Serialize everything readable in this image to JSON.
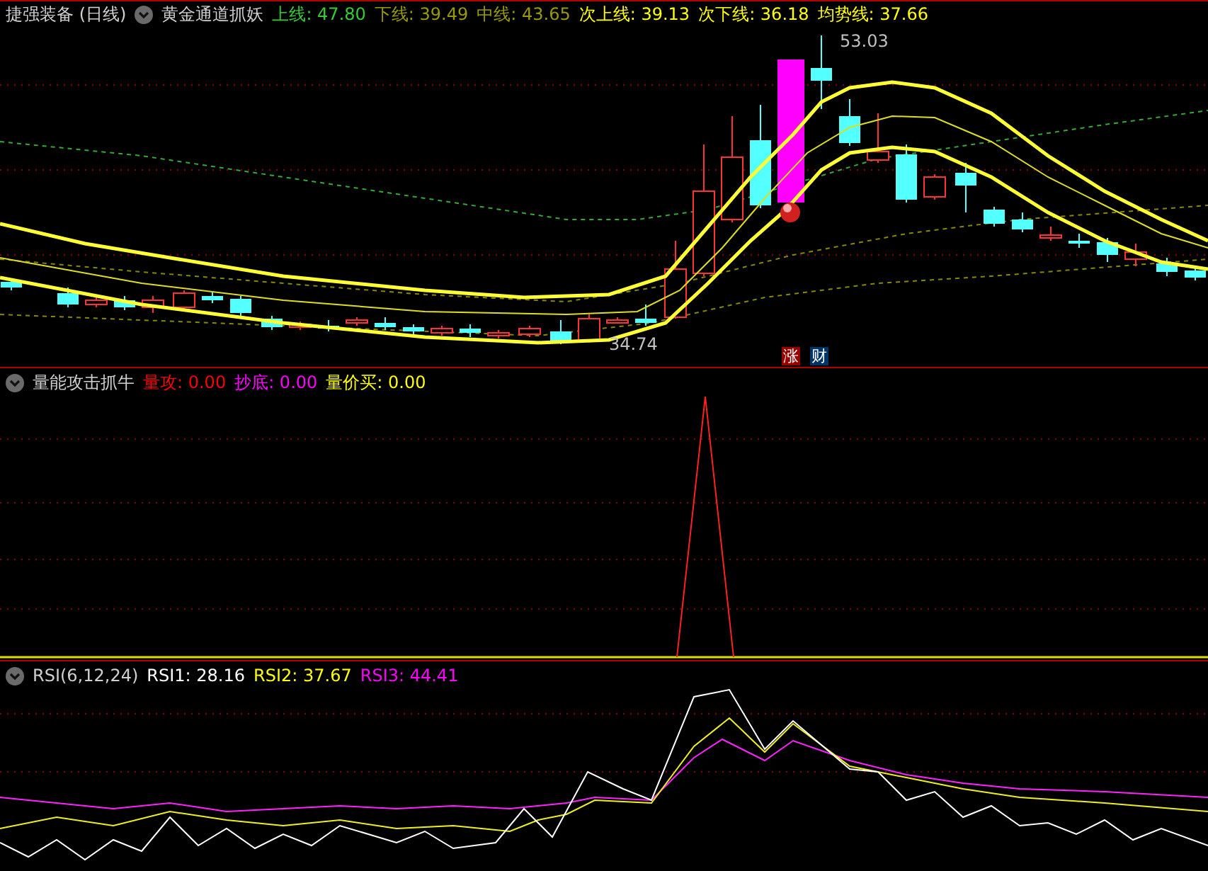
{
  "main_panel": {
    "title": "捷强装备 (日线)",
    "indicator": "黄金通道抓妖",
    "legend": [
      {
        "label": "上线: 47.80",
        "color": "#33cc33"
      },
      {
        "label": "下线: 39.49",
        "color": "#999900"
      },
      {
        "label": "中线: 43.65",
        "color": "#999900"
      },
      {
        "label": "次上线: 39.13",
        "color": "#ffff00"
      },
      {
        "label": "次下线: 36.18",
        "color": "#ffff00"
      },
      {
        "label": "均势线: 37.66",
        "color": "#ffff00"
      }
    ],
    "high_label": "53.03",
    "low_label": "34.74",
    "badges": [
      {
        "text": "涨",
        "color": "#990000"
      },
      {
        "text": "财",
        "color": "#003366"
      }
    ]
  },
  "volume_panel": {
    "indicator": "量能攻击抓牛",
    "legend": [
      {
        "label": "量攻: 0.00",
        "color": "#ff0000"
      },
      {
        "label": "抄底: 0.00",
        "color": "#ff00ff"
      },
      {
        "label": "量价买: 0.00",
        "color": "#ffff00"
      }
    ]
  },
  "rsi_panel": {
    "indicator": "RSI(6,12,24)",
    "legend": [
      {
        "label": "RSI1: 28.16",
        "color": "#ffffff"
      },
      {
        "label": "RSI2: 37.67",
        "color": "#ffff00"
      },
      {
        "label": "RSI3: 44.41",
        "color": "#ff00ff"
      }
    ]
  }
}
